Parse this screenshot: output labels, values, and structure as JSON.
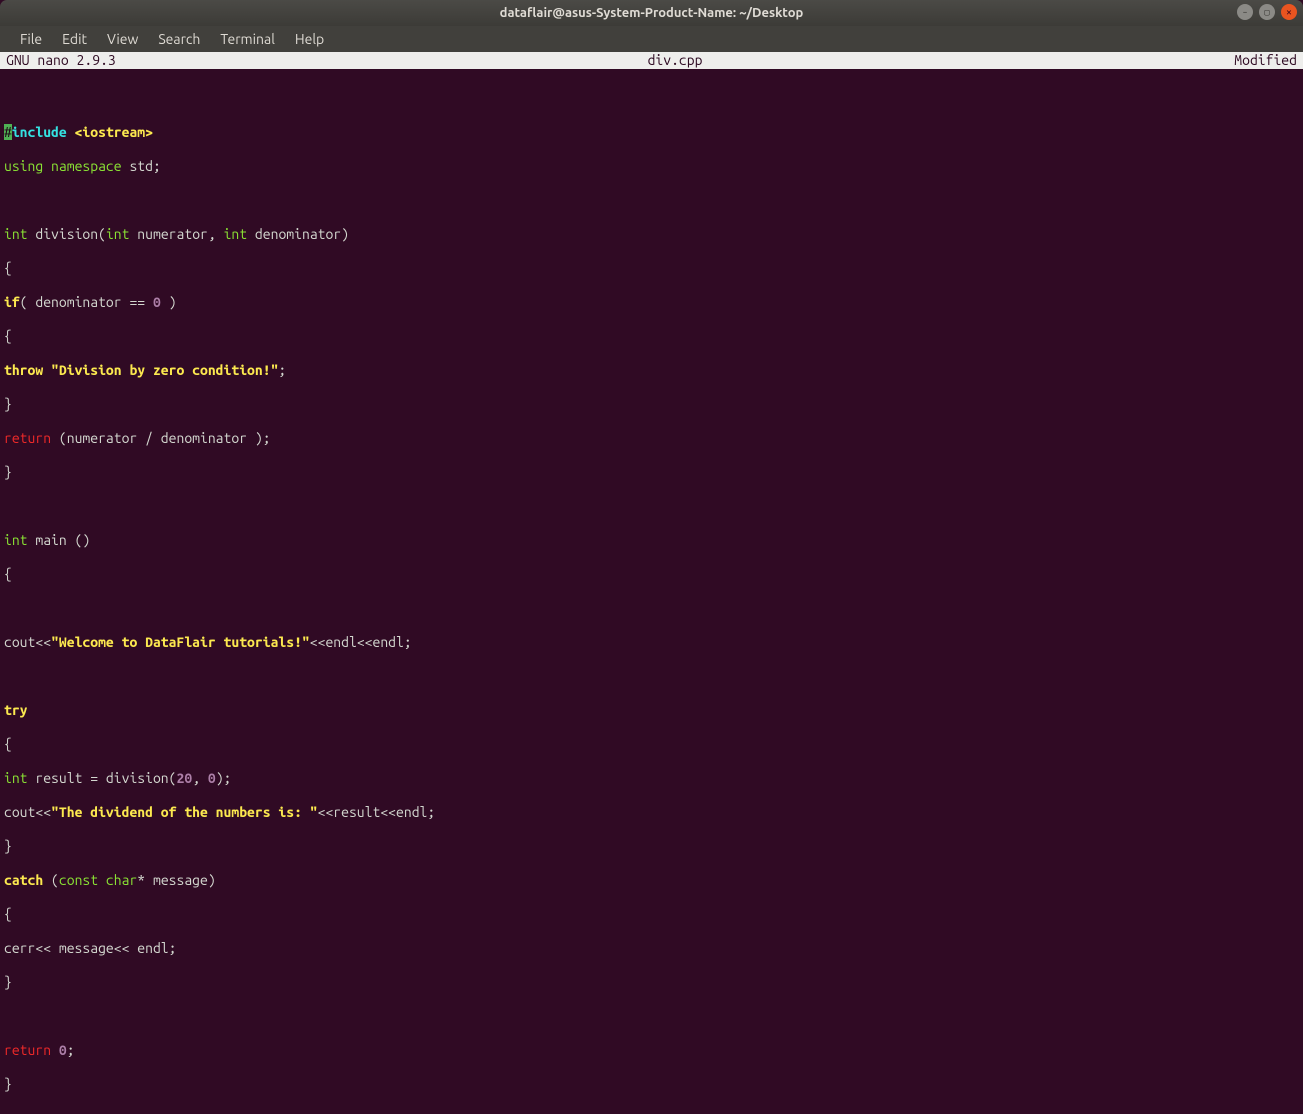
{
  "window": {
    "title": "dataflair@asus-System-Product-Name: ~/Desktop"
  },
  "menu": {
    "file": "File",
    "edit": "Edit",
    "view": "View",
    "search": "Search",
    "terminal": "Terminal",
    "help": "Help"
  },
  "nano": {
    "left": "  GNU nano 2.9.3",
    "center": "div.cpp",
    "right": "Modified  "
  },
  "code": {
    "l1_cursor": "#",
    "l1_inc": "include",
    "l1_hdr": "<iostream>",
    "l2_using": "using",
    "l2_ns": "namespace",
    "l2_std": " std;",
    "l4_int": "int",
    "l4_div": " division(",
    "l4_int2": "int",
    "l4_num": " numerator, ",
    "l4_int3": "int",
    "l4_den": " denominator)",
    "l5": "{",
    "l6_if": "if",
    "l6_cond": "( denominator == ",
    "l6_zero": "0",
    "l6_end": " )",
    "l7": "{",
    "l8_throw": "throw",
    "l8_sp": " ",
    "l8_str": "\"Division by zero condition!\"",
    "l8_semi": ";",
    "l9": "}",
    "l10_ret": "return",
    "l10_body": " (numerator / denominator );",
    "l11": "}",
    "l13_int": "int",
    "l13_main": " main ()",
    "l14": "{",
    "l16_pre": "cout<<",
    "l16_str": "\"Welcome to DataFlair tutorials!\"",
    "l16_post": "<<endl<<endl;",
    "l18_try": "try",
    "l19": "{",
    "l20_int": "int",
    "l20_rest": " result = division(",
    "l20_a": "20",
    "l20_c": ", ",
    "l20_b": "0",
    "l20_end": ");",
    "l21_pre": "cout<<",
    "l21_str": "\"The dividend of the numbers is: \"",
    "l21_post": "<<result<<endl;",
    "l22": "}",
    "l23_catch": "catch",
    "l23_sp": " (",
    "l23_const": "const",
    "l23_char": " char",
    "l23_rest": "* message)",
    "l24": "{",
    "l25": "cerr<< message<< endl;",
    "l26": "}",
    "l28_ret": "return",
    "l28_sp": " ",
    "l28_zero": "0",
    "l28_semi": ";",
    "l29": "}"
  }
}
